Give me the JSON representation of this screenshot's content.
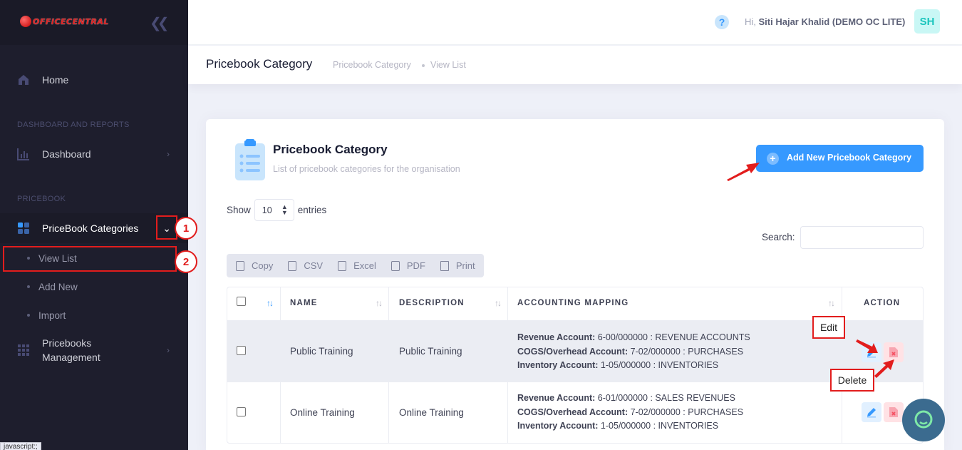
{
  "brand": {
    "logo_text": "OFFICECENTRAL"
  },
  "sidebar": {
    "home": "Home",
    "section_dashboard": "DASHBOARD AND REPORTS",
    "dashboard": "Dashboard",
    "section_pricebook": "PRICEBOOK",
    "pricebook_categories": "PriceBook Categories",
    "sub_items": [
      "View List",
      "Add New",
      "Import"
    ],
    "pricebooks_management_line1": "Pricebooks",
    "pricebooks_management_line2": "Management"
  },
  "annotations": {
    "step1": "1",
    "step2": "2",
    "edit_callout": "Edit",
    "delete_callout": "Delete"
  },
  "status_tip": "javascript:;",
  "header": {
    "help": "?",
    "greeting_prefix": "Hi,",
    "user_name": "Siti Hajar Khalid (DEMO OC LITE)",
    "avatar_initials": "SH"
  },
  "subheader": {
    "title": "Pricebook Category",
    "breadcrumb": [
      "Pricebook Category",
      "View List"
    ]
  },
  "card": {
    "title": "Pricebook Category",
    "subtitle": "List of pricebook categories for the organisation",
    "add_button": "Add New Pricebook Category"
  },
  "table_controls": {
    "show_label": "Show",
    "entries_value": "10",
    "entries_label": "entries",
    "search_label": "Search:",
    "export_buttons": [
      "Copy",
      "CSV",
      "Excel",
      "PDF",
      "Print"
    ]
  },
  "table": {
    "columns": [
      "NAME",
      "DESCRIPTION",
      "ACCOUNTING MAPPING",
      "ACTION"
    ],
    "rows": [
      {
        "name": "Public Training",
        "description": "Public Training",
        "revenue_label": "Revenue Account:",
        "revenue": "6-00/000000 : REVENUE ACCOUNTS",
        "cogs_label": "COGS/Overhead Account:",
        "cogs": "7-02/000000 : PURCHASES",
        "inventory_label": "Inventory Account:",
        "inventory": "1-05/000000 : INVENTORIES"
      },
      {
        "name": "Online Training",
        "description": "Online Training",
        "revenue_label": "Revenue Account:",
        "revenue": "6-01/000000 : SALES REVENUES",
        "cogs_label": "COGS/Overhead Account:",
        "cogs": "7-02/000000 : PURCHASES",
        "inventory_label": "Inventory Account:",
        "inventory": "1-05/000000 : INVENTORIES"
      }
    ]
  },
  "colors": {
    "primary": "#3699ff",
    "sidebar_bg": "#1e1e2d",
    "annotation_red": "#e21d1d"
  }
}
